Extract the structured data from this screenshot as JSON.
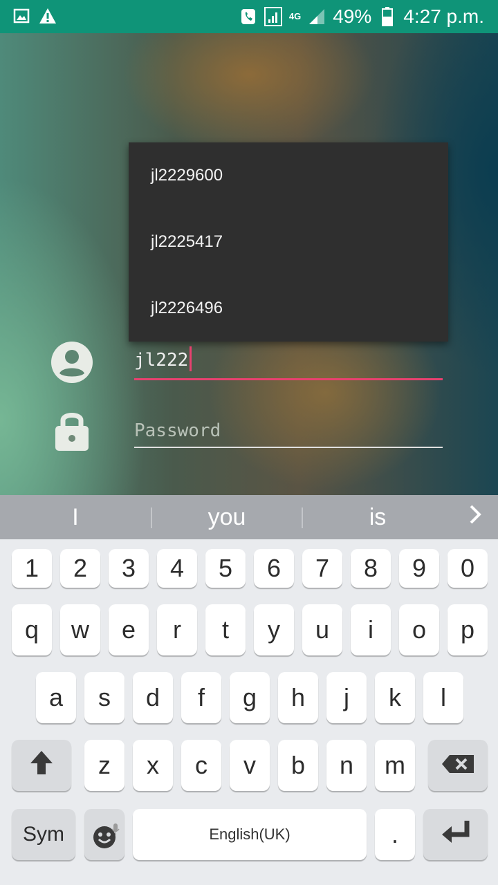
{
  "status_bar": {
    "left_icons": [
      "gallery-icon",
      "warning-icon"
    ],
    "right_icons": [
      "call-icon",
      "signal-sim1-icon",
      "signal-4g-icon",
      "battery-icon"
    ],
    "network": "4G",
    "battery": "49%",
    "time": "4:27 p.m."
  },
  "autocomplete": {
    "items": [
      "jl2229600",
      "jl2225417",
      "jl2226496"
    ]
  },
  "login": {
    "username_value": "jl222",
    "password_placeholder": "Password"
  },
  "keyboard": {
    "suggestions": [
      "I",
      "you",
      "is"
    ],
    "row_numbers": [
      "1",
      "2",
      "3",
      "4",
      "5",
      "6",
      "7",
      "8",
      "9",
      "0"
    ],
    "row_top": [
      "q",
      "w",
      "e",
      "r",
      "t",
      "y",
      "u",
      "i",
      "o",
      "p"
    ],
    "row_middle": [
      "a",
      "s",
      "d",
      "f",
      "g",
      "h",
      "j",
      "k",
      "l"
    ],
    "row_bottom": [
      "z",
      "x",
      "c",
      "v",
      "b",
      "n",
      "m"
    ],
    "sym_label": "Sym",
    "space_label": "English(UK)",
    "period_label": "."
  }
}
